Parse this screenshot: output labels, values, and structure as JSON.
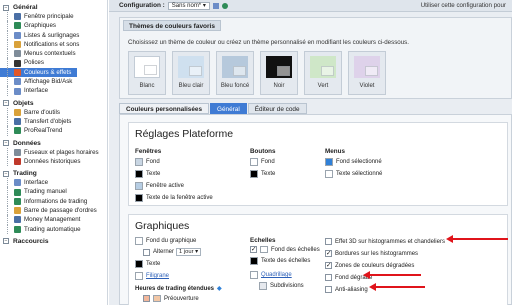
{
  "sidebar": {
    "sections": [
      {
        "title": "Général",
        "items": [
          {
            "label": "Fenêtre principale",
            "icon": "window-icon",
            "color": "#4a6fa5"
          },
          {
            "label": "Graphiques",
            "icon": "chart-icon",
            "color": "#2e8b57"
          },
          {
            "label": "Listes & surlignages",
            "icon": "list-icon",
            "color": "#6b8cc7"
          },
          {
            "label": "Notifications et sons",
            "icon": "bell-icon",
            "color": "#d9a13a"
          },
          {
            "label": "Menus contextuels",
            "icon": "menu-icon",
            "color": "#7f8c99"
          },
          {
            "label": "Polices",
            "icon": "font-icon",
            "color": "#333333"
          },
          {
            "label": "Couleurs & effets",
            "icon": "palette-icon",
            "color": "#e0572a",
            "active": true
          },
          {
            "label": "Affichage Bid/Ask",
            "icon": "bidask-icon",
            "color": "#6b8cc7"
          },
          {
            "label": "Interface",
            "icon": "interface-icon",
            "color": "#6b8cc7"
          }
        ]
      },
      {
        "title": "Objets",
        "items": [
          {
            "label": "Barre d'outils",
            "icon": "brush-icon",
            "color": "#d9a13a"
          },
          {
            "label": "Transfert d'objets",
            "icon": "transfer-icon",
            "color": "#4a6fa5"
          },
          {
            "label": "ProRealTrend",
            "icon": "trend-icon",
            "color": "#2e8b57"
          }
        ]
      },
      {
        "title": "Données",
        "items": [
          {
            "label": "Fuseaux et plages horaires",
            "icon": "clock-icon",
            "color": "#7f8c99"
          },
          {
            "label": "Données historiques",
            "icon": "history-icon",
            "color": "#c0392b"
          }
        ]
      },
      {
        "title": "Trading",
        "items": [
          {
            "label": "Interface",
            "icon": "interface-icon",
            "color": "#6b8cc7"
          },
          {
            "label": "Trading manuel",
            "icon": "manual-trading-icon",
            "color": "#2e8b57"
          },
          {
            "label": "Informations de trading",
            "icon": "info-trading-icon",
            "color": "#2e8b57"
          },
          {
            "label": "Barre de passage d'ordres",
            "icon": "order-bar-icon",
            "color": "#d9a13a"
          },
          {
            "label": "Money Management",
            "icon": "money-icon",
            "color": "#4a6fa5"
          },
          {
            "label": "Trading automatique",
            "icon": "auto-trading-icon",
            "color": "#2e8b57"
          }
        ]
      },
      {
        "title": "Raccourcis",
        "items": []
      }
    ]
  },
  "configbar": {
    "label": "Configuration :",
    "select_value": "Sans nom* ▾",
    "use_label": "Utiliser cette configuration pour"
  },
  "favorites": {
    "tab_label": "Thèmes de couleurs favoris",
    "description": "Choisissez un thème de couleur ou créez un thème personnalisé en modifiant les couleurs ci-dessous.",
    "themes": [
      {
        "label": "Blanc",
        "color": "#ffffff"
      },
      {
        "label": "Bleu clair",
        "color": "#cfe0ef"
      },
      {
        "label": "Bleu foncé",
        "color": "#b6c9dc"
      },
      {
        "label": "Noir",
        "color": "#111111"
      },
      {
        "label": "Vert",
        "color": "#cfe7c8"
      },
      {
        "label": "Violet",
        "color": "#ded2ea"
      }
    ]
  },
  "tabs": {
    "custom_label": "Couleurs personnalisées",
    "general_label": "Général",
    "code_editor_label": "Éditeur de code"
  },
  "platform": {
    "title": "Réglages Plateforme",
    "windows_header": "Fenêtres",
    "windows": [
      {
        "label": "Fond",
        "color": "#c9d6e3"
      },
      {
        "label": "Texte",
        "color": "#000000"
      },
      {
        "label": "Fenêtre active",
        "color": "#b6cde3"
      },
      {
        "label": "Texte de la fenêtre active",
        "color": "#000000"
      }
    ],
    "buttons_header": "Boutons",
    "buttons": [
      {
        "label": "Fond",
        "color": "#ffffff"
      },
      {
        "label": "Texte",
        "color": "#000000"
      }
    ],
    "menus_header": "Menus",
    "menus": [
      {
        "label": "Fond sélectionné",
        "color": "#2f80d8"
      },
      {
        "label": "Texte sélectionné",
        "color": "#ffffff"
      }
    ]
  },
  "graphics": {
    "title": "Graphiques",
    "bg_label": "Fond du graphique",
    "alternate_label": "Alterner",
    "alternate_value": "1 jour ▾",
    "text_label": "Texte",
    "grid_label": "Filigrane",
    "hours_label": "Heures de trading étendues",
    "premarket_label": "Préouverture",
    "scales_header": "Echelles",
    "scales_bg_label": "Fond des échelles",
    "scales_text_label": "Texte des échelles",
    "grid_link": "Quadrillage",
    "subdivisions_label": "Subdivisions",
    "effects": [
      {
        "label": "Effet 3D sur histogrammes et chandeliers",
        "checked": false
      },
      {
        "label": "Bordures sur les histogrammes",
        "checked": true
      },
      {
        "label": "Zones de couleurs dégradées",
        "checked": true
      },
      {
        "label": "Fond dégradé",
        "checked": false
      },
      {
        "label": "Anti-aliasing",
        "checked": false
      }
    ]
  },
  "colors": {
    "accent": "#3f7bd4",
    "annotation_red": "#e0141b"
  }
}
